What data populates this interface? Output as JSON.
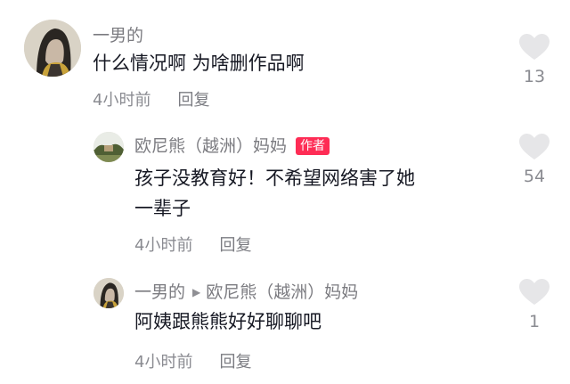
{
  "comments": [
    {
      "username": "一男的",
      "text": "什么情况啊 为啥删作品啊",
      "time": "4小时前",
      "reply_label": "回复",
      "likes": "13",
      "avatar_icon": "user-avatar-icon"
    },
    {
      "username": "欧尼熊（越洲）妈妈",
      "badge": "作者",
      "text_line1": "孩子没教育好！不希望网络害了她",
      "text_line2": "一辈子",
      "time": "4小时前",
      "reply_label": "回复",
      "likes": "54",
      "avatar_icon": "landscape-avatar-icon"
    },
    {
      "username": "一男的",
      "reply_to": "欧尼熊（越洲）妈妈",
      "text": "阿姨跟熊熊好好聊聊吧",
      "time": "4小时前",
      "reply_label": "回复",
      "likes": "1",
      "avatar_icon": "user-avatar-icon"
    }
  ],
  "colors": {
    "accent_badge": "#fe2c55",
    "username": "#7b7b80",
    "heart": "#e6e6e8"
  }
}
